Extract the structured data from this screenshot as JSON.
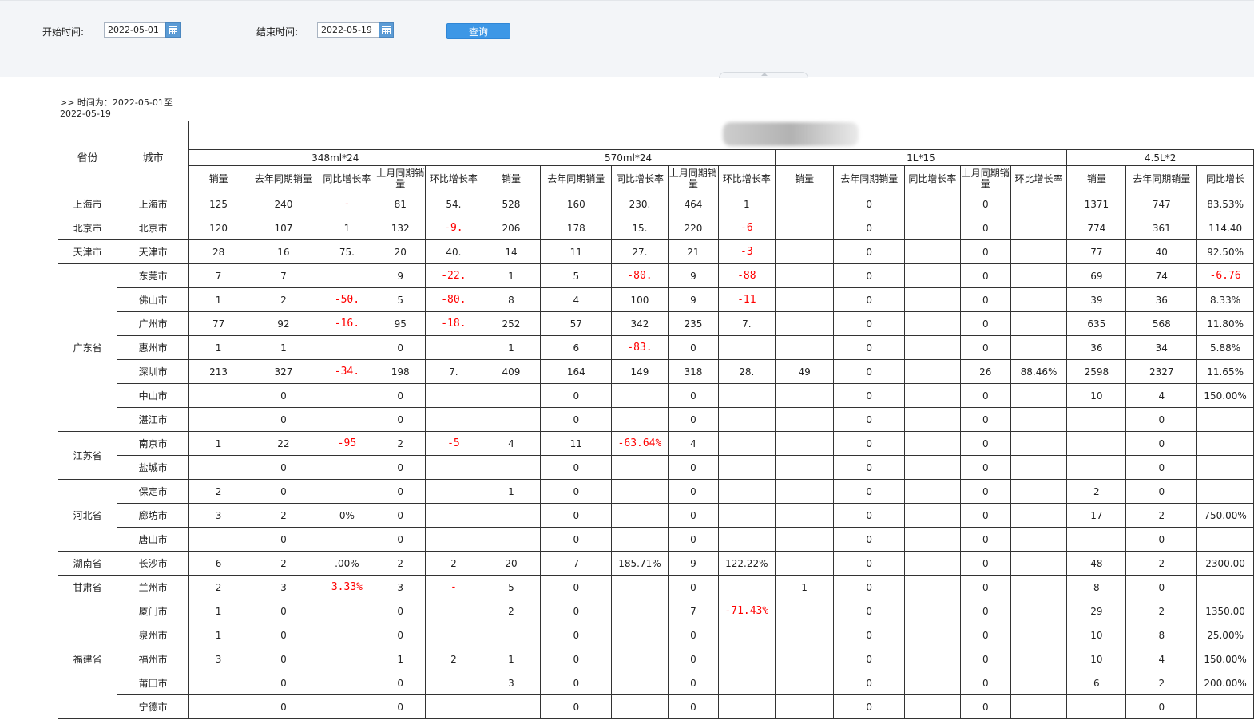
{
  "filters": {
    "start_label": "开始时间:",
    "start_value": "2022-05-01",
    "end_label": "结束时间:",
    "end_value": "2022-05-19",
    "query_button": "查询"
  },
  "caption": {
    "line1": ">> 时间为：2022-05-01至",
    "line2": "2022-05-19"
  },
  "table": {
    "province_header": "省份",
    "city_header": "城市",
    "groups": [
      "348ml*24",
      "570ml*24",
      "1L*15",
      "4.5L*2"
    ],
    "sub_headers": [
      "销量",
      "去年同期销量",
      "同比增长率",
      "上月同期销量",
      "环比增长率"
    ],
    "last_sub_header": "同比增长",
    "rows": [
      {
        "province": "上海市",
        "rowspan": 1,
        "city": "上海市",
        "cells": [
          [
            "125",
            "240",
            "-",
            "81",
            "54."
          ],
          [
            "528",
            "160",
            "230.",
            "464",
            "1"
          ],
          [
            "",
            "0",
            "",
            "0",
            ""
          ],
          [
            "1371",
            "747",
            "83.53%"
          ]
        ],
        "neg": [
          [
            2
          ],
          [],
          [],
          []
        ]
      },
      {
        "province": "北京市",
        "rowspan": 1,
        "city": "北京市",
        "cells": [
          [
            "120",
            "107",
            "1",
            "132",
            "-9."
          ],
          [
            "206",
            "178",
            "15.",
            "220",
            "-6"
          ],
          [
            "",
            "0",
            "",
            "0",
            ""
          ],
          [
            "774",
            "361",
            "114.40"
          ]
        ],
        "neg": [
          [
            4
          ],
          [
            4
          ],
          [],
          []
        ]
      },
      {
        "province": "天津市",
        "rowspan": 1,
        "city": "天津市",
        "cells": [
          [
            "28",
            "16",
            "75.",
            "20",
            "40."
          ],
          [
            "14",
            "11",
            "27.",
            "21",
            "-3"
          ],
          [
            "",
            "0",
            "",
            "0",
            ""
          ],
          [
            "77",
            "40",
            "92.50%"
          ]
        ],
        "neg": [
          [],
          [
            4
          ],
          [],
          []
        ]
      },
      {
        "province": "广东省",
        "rowspan": 7,
        "city": "东莞市",
        "cells": [
          [
            "7",
            "7",
            "",
            "9",
            "-22."
          ],
          [
            "1",
            "5",
            "-80.",
            "9",
            "-88"
          ],
          [
            "",
            "0",
            "",
            "0",
            ""
          ],
          [
            "69",
            "74",
            "-6.76"
          ]
        ],
        "neg": [
          [
            4
          ],
          [
            2,
            4
          ],
          [],
          [
            2
          ]
        ]
      },
      {
        "province": "",
        "rowspan": 0,
        "city": "佛山市",
        "cells": [
          [
            "1",
            "2",
            "-50.",
            "5",
            "-80."
          ],
          [
            "8",
            "4",
            "100",
            "9",
            "-11"
          ],
          [
            "",
            "0",
            "",
            "0",
            ""
          ],
          [
            "39",
            "36",
            "8.33%"
          ]
        ],
        "neg": [
          [
            2,
            4
          ],
          [
            4
          ],
          [],
          []
        ]
      },
      {
        "province": "",
        "rowspan": 0,
        "city": "广州市",
        "cells": [
          [
            "77",
            "92",
            "-16.",
            "95",
            "-18."
          ],
          [
            "252",
            "57",
            "342",
            "235",
            "7."
          ],
          [
            "",
            "0",
            "",
            "0",
            ""
          ],
          [
            "635",
            "568",
            "11.80%"
          ]
        ],
        "neg": [
          [
            2,
            4
          ],
          [],
          [],
          []
        ]
      },
      {
        "province": "",
        "rowspan": 0,
        "city": "惠州市",
        "cells": [
          [
            "1",
            "1",
            "",
            "0",
            ""
          ],
          [
            "1",
            "6",
            "-83.",
            "0",
            ""
          ],
          [
            "",
            "0",
            "",
            "0",
            ""
          ],
          [
            "36",
            "34",
            "5.88%"
          ]
        ],
        "neg": [
          [],
          [
            2
          ],
          [],
          []
        ]
      },
      {
        "province": "",
        "rowspan": 0,
        "city": "深圳市",
        "cells": [
          [
            "213",
            "327",
            "-34.",
            "198",
            "7."
          ],
          [
            "409",
            "164",
            "149",
            "318",
            "28."
          ],
          [
            "49",
            "0",
            "",
            "26",
            "88.46%"
          ],
          [
            "2598",
            "2327",
            "11.65%"
          ]
        ],
        "neg": [
          [
            2
          ],
          [],
          [],
          []
        ]
      },
      {
        "province": "",
        "rowspan": 0,
        "city": "中山市",
        "cells": [
          [
            "",
            "0",
            "",
            "0",
            ""
          ],
          [
            "",
            "0",
            "",
            "0",
            ""
          ],
          [
            "",
            "0",
            "",
            "0",
            ""
          ],
          [
            "10",
            "4",
            "150.00%"
          ]
        ],
        "neg": [
          [],
          [],
          [],
          []
        ]
      },
      {
        "province": "",
        "rowspan": 0,
        "city": "湛江市",
        "cells": [
          [
            "",
            "0",
            "",
            "0",
            ""
          ],
          [
            "",
            "0",
            "",
            "0",
            ""
          ],
          [
            "",
            "0",
            "",
            "0",
            ""
          ],
          [
            "",
            "0",
            ""
          ]
        ],
        "neg": [
          [],
          [],
          [],
          []
        ]
      },
      {
        "province": "江苏省",
        "rowspan": 2,
        "city": "南京市",
        "cells": [
          [
            "1",
            "22",
            "-95",
            "2",
            "-5"
          ],
          [
            "4",
            "11",
            "-63.64%",
            "4",
            ""
          ],
          [
            "",
            "0",
            "",
            "0",
            ""
          ],
          [
            "",
            "0",
            ""
          ]
        ],
        "neg": [
          [
            2,
            4
          ],
          [
            2
          ],
          [],
          []
        ]
      },
      {
        "province": "",
        "rowspan": 0,
        "city": "盐城市",
        "cells": [
          [
            "",
            "0",
            "",
            "0",
            ""
          ],
          [
            "",
            "0",
            "",
            "0",
            ""
          ],
          [
            "",
            "0",
            "",
            "0",
            ""
          ],
          [
            "",
            "0",
            ""
          ]
        ],
        "neg": [
          [],
          [],
          [],
          []
        ]
      },
      {
        "province": "河北省",
        "rowspan": 3,
        "city": "保定市",
        "cells": [
          [
            "2",
            "0",
            "",
            "0",
            ""
          ],
          [
            "1",
            "0",
            "",
            "0",
            ""
          ],
          [
            "",
            "0",
            "",
            "0",
            ""
          ],
          [
            "2",
            "0",
            ""
          ]
        ],
        "neg": [
          [],
          [],
          [],
          []
        ]
      },
      {
        "province": "",
        "rowspan": 0,
        "city": "廊坊市",
        "cells": [
          [
            "3",
            "2",
            "0%",
            "0",
            ""
          ],
          [
            "",
            "0",
            "",
            "0",
            ""
          ],
          [
            "",
            "0",
            "",
            "0",
            ""
          ],
          [
            "17",
            "2",
            "750.00%"
          ]
        ],
        "neg": [
          [],
          [],
          [],
          []
        ]
      },
      {
        "province": "",
        "rowspan": 0,
        "city": "唐山市",
        "cells": [
          [
            "",
            "0",
            "",
            "0",
            ""
          ],
          [
            "",
            "0",
            "",
            "0",
            ""
          ],
          [
            "",
            "0",
            "",
            "0",
            ""
          ],
          [
            "",
            "0",
            ""
          ]
        ],
        "neg": [
          [],
          [],
          [],
          []
        ]
      },
      {
        "province": "湖南省",
        "rowspan": 1,
        "city": "长沙市",
        "cells": [
          [
            "6",
            "2",
            ".00%",
            "2",
            "2"
          ],
          [
            "20",
            "7",
            "185.71%",
            "9",
            "122.22%"
          ],
          [
            "",
            "0",
            "",
            "0",
            ""
          ],
          [
            "48",
            "2",
            "2300.00"
          ]
        ],
        "neg": [
          [],
          [],
          [],
          []
        ]
      },
      {
        "province": "甘肃省",
        "rowspan": 1,
        "city": "兰州市",
        "cells": [
          [
            "2",
            "3",
            "3.33%",
            "3",
            "-"
          ],
          [
            "5",
            "0",
            "",
            "0",
            ""
          ],
          [
            "1",
            "0",
            "",
            "0",
            ""
          ],
          [
            "8",
            "0",
            ""
          ]
        ],
        "neg": [
          [
            2,
            4
          ],
          [],
          [],
          []
        ]
      },
      {
        "province": "福建省",
        "rowspan": 5,
        "city": "厦门市",
        "cells": [
          [
            "1",
            "0",
            "",
            "0",
            ""
          ],
          [
            "2",
            "0",
            "",
            "7",
            "-71.43%"
          ],
          [
            "",
            "0",
            "",
            "0",
            ""
          ],
          [
            "29",
            "2",
            "1350.00"
          ]
        ],
        "neg": [
          [],
          [
            4
          ],
          [],
          []
        ]
      },
      {
        "province": "",
        "rowspan": 0,
        "city": "泉州市",
        "cells": [
          [
            "1",
            "0",
            "",
            "0",
            ""
          ],
          [
            "",
            "0",
            "",
            "0",
            ""
          ],
          [
            "",
            "0",
            "",
            "0",
            ""
          ],
          [
            "10",
            "8",
            "25.00%"
          ]
        ],
        "neg": [
          [],
          [],
          [],
          []
        ]
      },
      {
        "province": "",
        "rowspan": 0,
        "city": "福州市",
        "cells": [
          [
            "3",
            "0",
            "",
            "1",
            "2"
          ],
          [
            "1",
            "0",
            "",
            "0",
            ""
          ],
          [
            "",
            "0",
            "",
            "0",
            ""
          ],
          [
            "10",
            "4",
            "150.00%"
          ]
        ],
        "neg": [
          [],
          [],
          [],
          []
        ]
      },
      {
        "province": "",
        "rowspan": 0,
        "city": "莆田市",
        "cells": [
          [
            "",
            "0",
            "",
            "0",
            ""
          ],
          [
            "3",
            "0",
            "",
            "0",
            ""
          ],
          [
            "",
            "0",
            "",
            "0",
            ""
          ],
          [
            "6",
            "2",
            "200.00%"
          ]
        ],
        "neg": [
          [],
          [],
          [],
          []
        ]
      },
      {
        "province": "",
        "rowspan": 0,
        "city": "宁德市",
        "cells": [
          [
            "",
            "0",
            "",
            "0",
            ""
          ],
          [
            "",
            "0",
            "",
            "0",
            ""
          ],
          [
            "",
            "0",
            "",
            "0",
            ""
          ],
          [
            "",
            "0",
            ""
          ]
        ],
        "neg": [
          [],
          [],
          [],
          []
        ]
      }
    ]
  }
}
